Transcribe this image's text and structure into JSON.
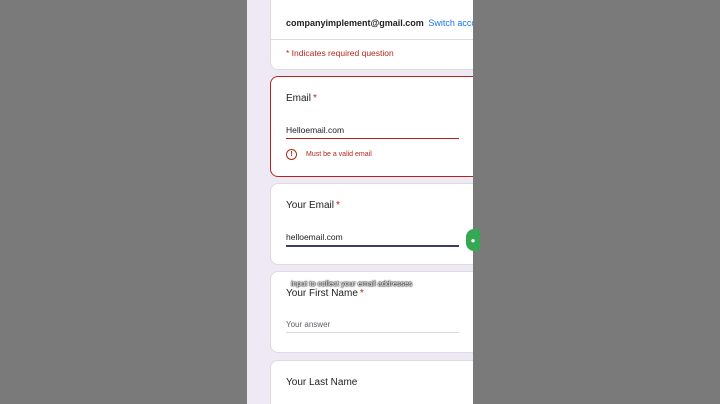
{
  "account": {
    "email": "companyimplement@gmail.com",
    "switch_label": "Switch account",
    "required_note": "* Indicates required question"
  },
  "questions": [
    {
      "title": "Email",
      "required_mark": "*",
      "value": "Helloemail.com",
      "error": "Must be a valid email",
      "error_icon": "alert-circle-icon"
    },
    {
      "title": "Your Email",
      "required_mark": "*",
      "value": "helloemail.com"
    },
    {
      "title": "Your First Name",
      "required_mark": "*",
      "placeholder": "Your answer"
    },
    {
      "title": "Your Last Name"
    }
  ],
  "caption": "input to collect your email addresses",
  "side_badge_icon": "chat-bubble-icon",
  "colors": {
    "error": "#b3261e",
    "link": "#1a73e8",
    "background": "#efe9f6",
    "side_badge": "#34a853"
  }
}
